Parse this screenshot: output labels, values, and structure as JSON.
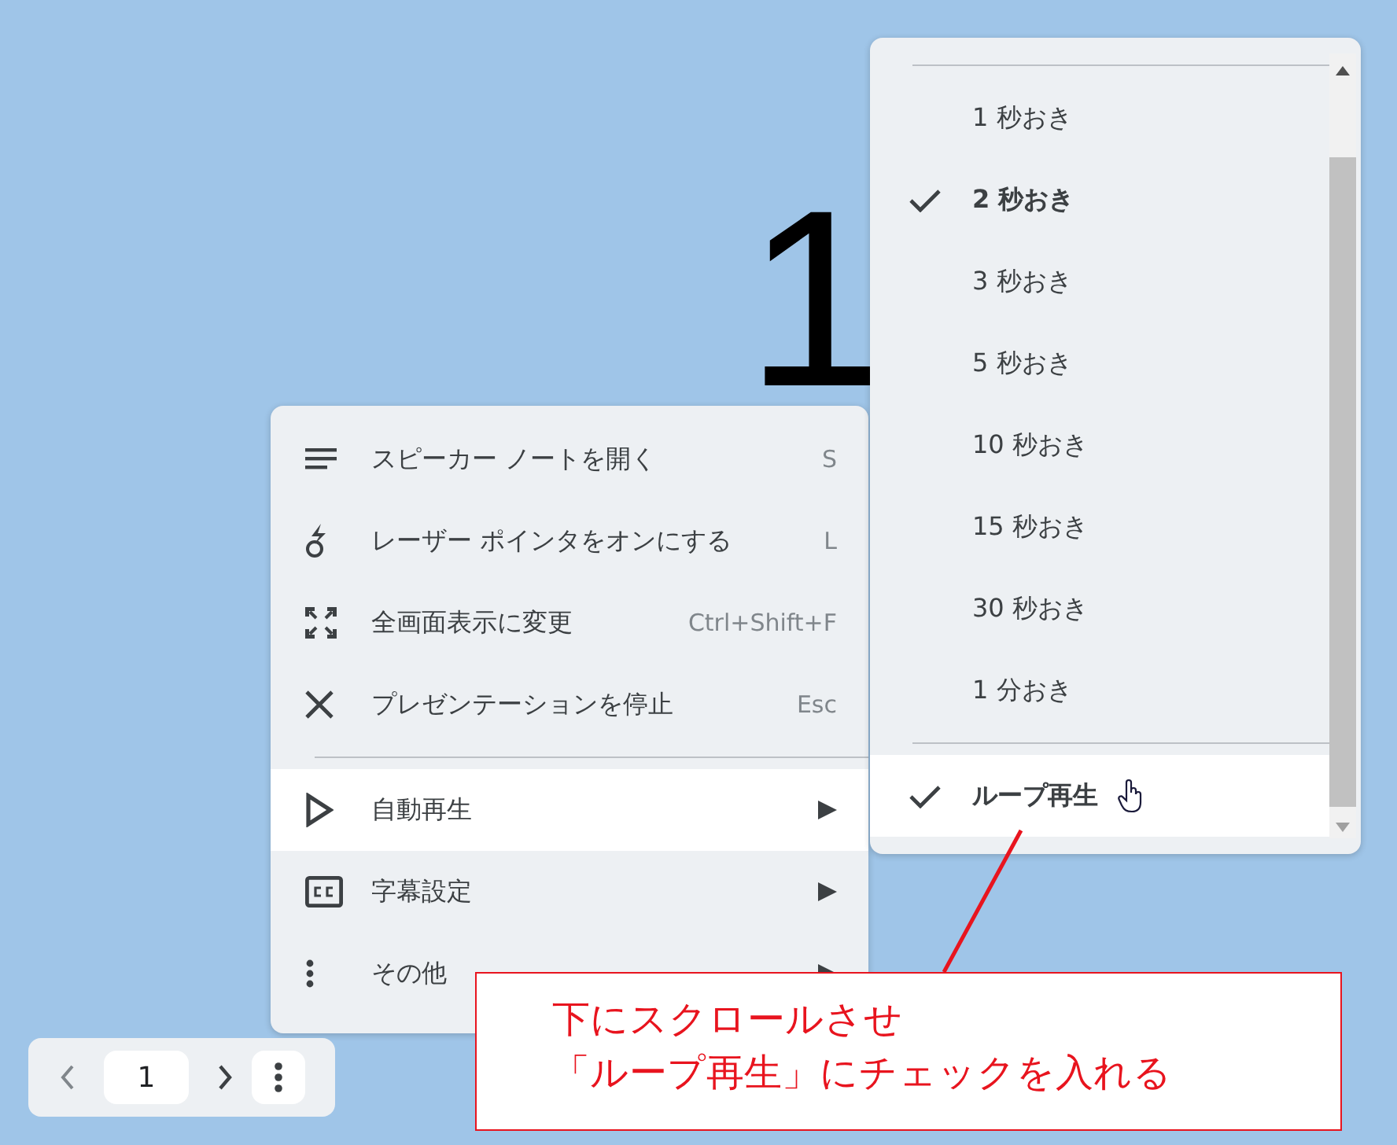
{
  "slide": {
    "title": "1"
  },
  "menu": {
    "items": [
      {
        "kind": "item",
        "label": "スピーカー ノートを開く",
        "shortcut": "S",
        "submenu": false,
        "selected": false
      },
      {
        "kind": "item",
        "label": "レーザー ポインタをオンにする",
        "shortcut": "L",
        "submenu": false,
        "selected": false
      },
      {
        "kind": "item",
        "label": "全画面表示に変更",
        "shortcut": "Ctrl+Shift+F",
        "submenu": false,
        "selected": false
      },
      {
        "kind": "item",
        "label": "プレゼンテーションを停止",
        "shortcut": "Esc",
        "submenu": false,
        "selected": false
      },
      {
        "kind": "divider"
      },
      {
        "kind": "item",
        "label": "自動再生",
        "submenu": true,
        "selected": true
      },
      {
        "kind": "item",
        "label": "字幕設定",
        "submenu": true,
        "selected": false
      },
      {
        "kind": "item",
        "label": "その他",
        "submenu": true,
        "selected": false
      }
    ]
  },
  "submenu": {
    "items": [
      {
        "kind": "divider"
      },
      {
        "kind": "option",
        "label": "1 秒おき",
        "checked": false,
        "selected": false
      },
      {
        "kind": "option",
        "label": "2 秒おき",
        "checked": true,
        "selected": false
      },
      {
        "kind": "option",
        "label": "3 秒おき",
        "checked": false,
        "selected": false
      },
      {
        "kind": "option",
        "label": "5 秒おき",
        "checked": false,
        "selected": false
      },
      {
        "kind": "option",
        "label": "10 秒おき",
        "checked": false,
        "selected": false
      },
      {
        "kind": "option",
        "label": "15 秒おき",
        "checked": false,
        "selected": false
      },
      {
        "kind": "option",
        "label": "30 秒おき",
        "checked": false,
        "selected": false
      },
      {
        "kind": "option",
        "label": "1 分おき",
        "checked": false,
        "selected": false
      },
      {
        "kind": "divider"
      },
      {
        "kind": "option",
        "label": "ループ再生",
        "checked": true,
        "selected": true
      }
    ]
  },
  "nav": {
    "page": "1"
  },
  "annotation": {
    "lines": [
      "下にスクロールさせ",
      "「ループ再生」にチェックを入れる"
    ]
  }
}
